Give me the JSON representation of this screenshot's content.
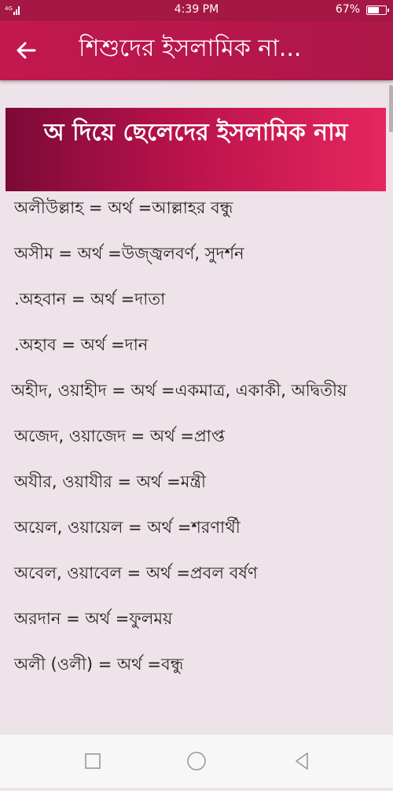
{
  "status_bar": {
    "time": "4:39 PM",
    "battery_percent": "67%",
    "battery_level": 0.67,
    "signal_icon": "signal-icon",
    "battery_icon": "battery-icon"
  },
  "app_bar": {
    "back_icon": "arrow-left-icon",
    "title": "শিশুদের ইসলামিক না..."
  },
  "header": {
    "title": "অ দিয়ে ছেলেদের ইসলামিক নাম"
  },
  "names": [
    {
      "text": "অলীউল্লাহ  =  অর্থ =আল্লাহর বন্ধু"
    },
    {
      "text": "অসীম  =  অর্থ =উজ্জ্বলবর্ণ, সুদর্শন"
    },
    {
      "text": ".অহবান  =  অর্থ =দাতা"
    },
    {
      "text": ".অহাব  =  অর্থ =দান"
    },
    {
      "text": "অহীদ, ওয়াহীদ  =  অর্থ =একমাত্র, একাকী, অদ্বিতীয়"
    },
    {
      "text": "অজেদ, ওয়াজেদ  =  অর্থ =প্রাপ্ত"
    },
    {
      "text": "অযীর, ওয়াযীর  =  অর্থ =মন্ত্রী"
    },
    {
      "text": "অয়েল, ওয়ায়েল  =  অর্থ =শরণার্থী"
    },
    {
      "text": "অবেল, ওয়াবেল  =  অর্থ =প্রবল বর্ষণ"
    },
    {
      "text": "অরদান  =  অর্থ =ফুলময়"
    },
    {
      "text": "অলী (ওলী) =  অর্থ =বন্ধু"
    }
  ],
  "nav_bar": {
    "recents_icon": "square-icon",
    "home_icon": "circle-icon",
    "back_icon": "triangle-back-icon"
  },
  "colors": {
    "app_bar": "#c2184f",
    "status_bar": "#a51845",
    "banner_start": "#7b0a36",
    "banner_end": "#e6265f",
    "background": "#ede3e8"
  }
}
